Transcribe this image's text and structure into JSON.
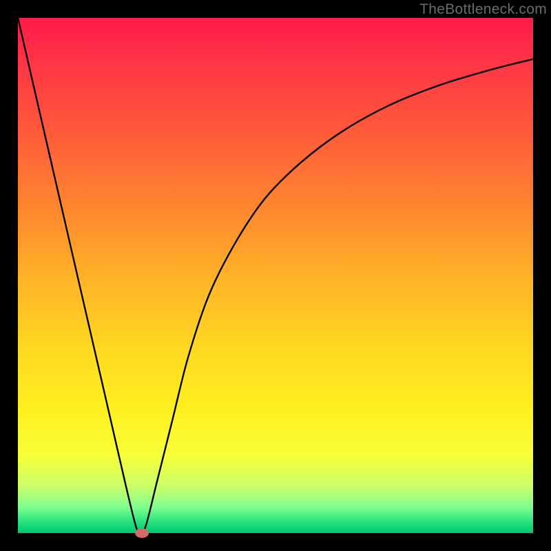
{
  "watermark": "TheBottleneck.com",
  "chart_data": {
    "type": "line",
    "title": "",
    "xlabel": "",
    "ylabel": "",
    "xlim": [
      0,
      100
    ],
    "ylim": [
      0,
      100
    ],
    "grid": false,
    "legend": false,
    "series": [
      {
        "name": "bottleneck-curve",
        "x": [
          0,
          3,
          6,
          9,
          12,
          15,
          18,
          21,
          23,
          24,
          25,
          27,
          30,
          33,
          37,
          42,
          48,
          55,
          63,
          72,
          82,
          92,
          100
        ],
        "y": [
          100,
          87,
          74,
          61,
          48,
          35,
          22,
          9,
          1,
          0,
          2,
          10,
          22,
          34,
          46,
          56,
          65,
          72,
          78,
          83,
          87,
          90,
          92
        ]
      }
    ],
    "annotations": [
      {
        "name": "vertex-marker",
        "x": 24,
        "y": 0,
        "shape": "ellipse",
        "color": "#d46a6a"
      }
    ],
    "background_gradient_stops": [
      {
        "pos": 0.0,
        "color": "#ff1a4b"
      },
      {
        "pos": 0.5,
        "color": "#ffc823"
      },
      {
        "pos": 0.85,
        "color": "#f7ff3a"
      },
      {
        "pos": 1.0,
        "color": "#00c56e"
      }
    ]
  }
}
